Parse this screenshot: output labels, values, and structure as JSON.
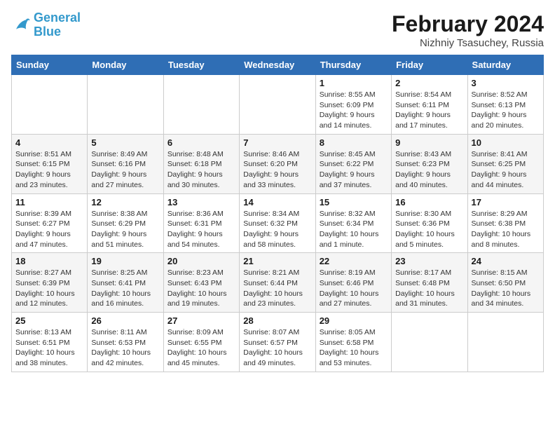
{
  "logo": {
    "text_general": "General",
    "text_blue": "Blue"
  },
  "title": "February 2024",
  "location": "Nizhniy Tsasuchey, Russia",
  "days_of_week": [
    "Sunday",
    "Monday",
    "Tuesday",
    "Wednesday",
    "Thursday",
    "Friday",
    "Saturday"
  ],
  "weeks": [
    [
      {
        "day": "",
        "info": ""
      },
      {
        "day": "",
        "info": ""
      },
      {
        "day": "",
        "info": ""
      },
      {
        "day": "",
        "info": ""
      },
      {
        "day": "1",
        "info": "Sunrise: 8:55 AM\nSunset: 6:09 PM\nDaylight: 9 hours\nand 14 minutes."
      },
      {
        "day": "2",
        "info": "Sunrise: 8:54 AM\nSunset: 6:11 PM\nDaylight: 9 hours\nand 17 minutes."
      },
      {
        "day": "3",
        "info": "Sunrise: 8:52 AM\nSunset: 6:13 PM\nDaylight: 9 hours\nand 20 minutes."
      }
    ],
    [
      {
        "day": "4",
        "info": "Sunrise: 8:51 AM\nSunset: 6:15 PM\nDaylight: 9 hours\nand 23 minutes."
      },
      {
        "day": "5",
        "info": "Sunrise: 8:49 AM\nSunset: 6:16 PM\nDaylight: 9 hours\nand 27 minutes."
      },
      {
        "day": "6",
        "info": "Sunrise: 8:48 AM\nSunset: 6:18 PM\nDaylight: 9 hours\nand 30 minutes."
      },
      {
        "day": "7",
        "info": "Sunrise: 8:46 AM\nSunset: 6:20 PM\nDaylight: 9 hours\nand 33 minutes."
      },
      {
        "day": "8",
        "info": "Sunrise: 8:45 AM\nSunset: 6:22 PM\nDaylight: 9 hours\nand 37 minutes."
      },
      {
        "day": "9",
        "info": "Sunrise: 8:43 AM\nSunset: 6:23 PM\nDaylight: 9 hours\nand 40 minutes."
      },
      {
        "day": "10",
        "info": "Sunrise: 8:41 AM\nSunset: 6:25 PM\nDaylight: 9 hours\nand 44 minutes."
      }
    ],
    [
      {
        "day": "11",
        "info": "Sunrise: 8:39 AM\nSunset: 6:27 PM\nDaylight: 9 hours\nand 47 minutes."
      },
      {
        "day": "12",
        "info": "Sunrise: 8:38 AM\nSunset: 6:29 PM\nDaylight: 9 hours\nand 51 minutes."
      },
      {
        "day": "13",
        "info": "Sunrise: 8:36 AM\nSunset: 6:31 PM\nDaylight: 9 hours\nand 54 minutes."
      },
      {
        "day": "14",
        "info": "Sunrise: 8:34 AM\nSunset: 6:32 PM\nDaylight: 9 hours\nand 58 minutes."
      },
      {
        "day": "15",
        "info": "Sunrise: 8:32 AM\nSunset: 6:34 PM\nDaylight: 10 hours\nand 1 minute."
      },
      {
        "day": "16",
        "info": "Sunrise: 8:30 AM\nSunset: 6:36 PM\nDaylight: 10 hours\nand 5 minutes."
      },
      {
        "day": "17",
        "info": "Sunrise: 8:29 AM\nSunset: 6:38 PM\nDaylight: 10 hours\nand 8 minutes."
      }
    ],
    [
      {
        "day": "18",
        "info": "Sunrise: 8:27 AM\nSunset: 6:39 PM\nDaylight: 10 hours\nand 12 minutes."
      },
      {
        "day": "19",
        "info": "Sunrise: 8:25 AM\nSunset: 6:41 PM\nDaylight: 10 hours\nand 16 minutes."
      },
      {
        "day": "20",
        "info": "Sunrise: 8:23 AM\nSunset: 6:43 PM\nDaylight: 10 hours\nand 19 minutes."
      },
      {
        "day": "21",
        "info": "Sunrise: 8:21 AM\nSunset: 6:44 PM\nDaylight: 10 hours\nand 23 minutes."
      },
      {
        "day": "22",
        "info": "Sunrise: 8:19 AM\nSunset: 6:46 PM\nDaylight: 10 hours\nand 27 minutes."
      },
      {
        "day": "23",
        "info": "Sunrise: 8:17 AM\nSunset: 6:48 PM\nDaylight: 10 hours\nand 31 minutes."
      },
      {
        "day": "24",
        "info": "Sunrise: 8:15 AM\nSunset: 6:50 PM\nDaylight: 10 hours\nand 34 minutes."
      }
    ],
    [
      {
        "day": "25",
        "info": "Sunrise: 8:13 AM\nSunset: 6:51 PM\nDaylight: 10 hours\nand 38 minutes."
      },
      {
        "day": "26",
        "info": "Sunrise: 8:11 AM\nSunset: 6:53 PM\nDaylight: 10 hours\nand 42 minutes."
      },
      {
        "day": "27",
        "info": "Sunrise: 8:09 AM\nSunset: 6:55 PM\nDaylight: 10 hours\nand 45 minutes."
      },
      {
        "day": "28",
        "info": "Sunrise: 8:07 AM\nSunset: 6:57 PM\nDaylight: 10 hours\nand 49 minutes."
      },
      {
        "day": "29",
        "info": "Sunrise: 8:05 AM\nSunset: 6:58 PM\nDaylight: 10 hours\nand 53 minutes."
      },
      {
        "day": "",
        "info": ""
      },
      {
        "day": "",
        "info": ""
      }
    ]
  ]
}
